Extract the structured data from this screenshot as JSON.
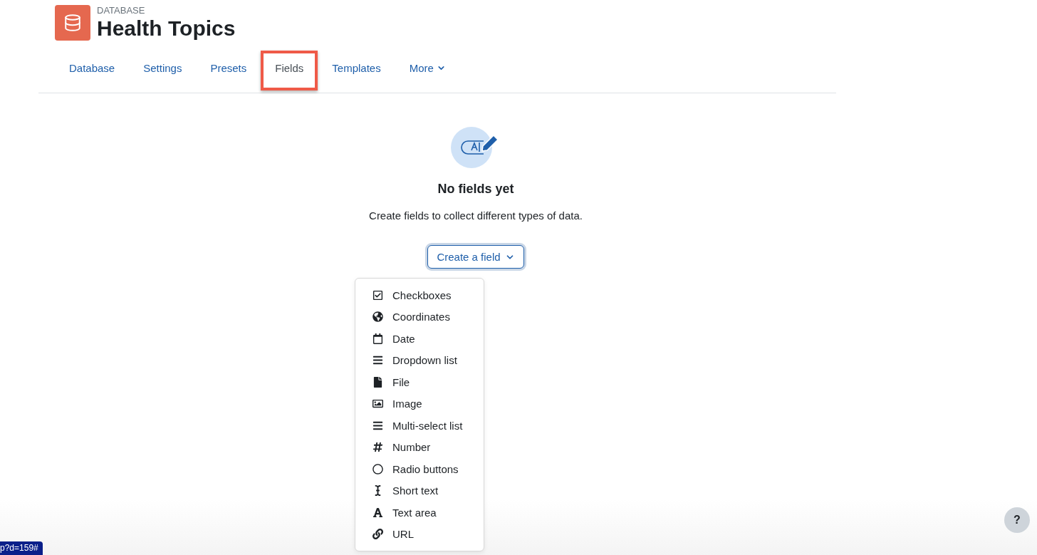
{
  "header": {
    "eyebrow": "DATABASE",
    "title": "Health Topics"
  },
  "tabs": [
    {
      "label": "Database",
      "selected": false,
      "highlighted": false
    },
    {
      "label": "Settings",
      "selected": false,
      "highlighted": false
    },
    {
      "label": "Presets",
      "selected": false,
      "highlighted": false
    },
    {
      "label": "Fields",
      "selected": true,
      "highlighted": true
    },
    {
      "label": "Templates",
      "selected": false,
      "highlighted": false
    },
    {
      "label": "More",
      "selected": false,
      "highlighted": false,
      "dropdown": true
    }
  ],
  "empty_state": {
    "heading": "No fields yet",
    "text": "Create fields to collect different types of data."
  },
  "create_button": {
    "label": "Create a field",
    "expanded": true
  },
  "menu": [
    {
      "kind": "checkboxes",
      "label": "Checkboxes"
    },
    {
      "kind": "coordinates",
      "label": "Coordinates"
    },
    {
      "kind": "date",
      "label": "Date"
    },
    {
      "kind": "list",
      "label": "Dropdown list"
    },
    {
      "kind": "file",
      "label": "File"
    },
    {
      "kind": "image",
      "label": "Image"
    },
    {
      "kind": "list",
      "label": "Multi-select list"
    },
    {
      "kind": "number",
      "label": "Number"
    },
    {
      "kind": "radio",
      "label": "Radio buttons"
    },
    {
      "kind": "shorttext",
      "label": "Short text"
    },
    {
      "kind": "textarea",
      "label": "Text area"
    },
    {
      "kind": "url",
      "label": "URL"
    }
  ],
  "status_url": "p?d=159#",
  "help_button": {
    "label": "?"
  }
}
